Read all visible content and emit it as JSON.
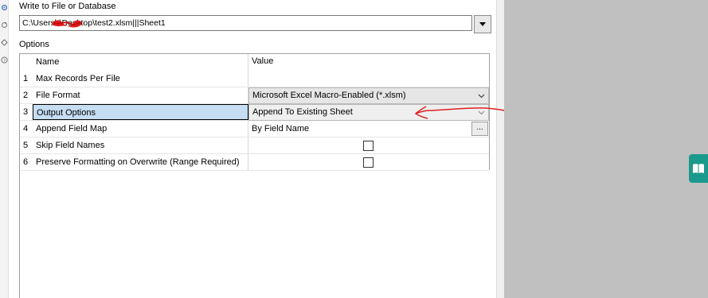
{
  "section": {
    "title": "Write to File or Database",
    "options_label": "Options"
  },
  "path": {
    "value": "C:\\Users\\        \\Desktop\\test2.xlsm|||Sheet1"
  },
  "grid": {
    "headers": {
      "name": "Name",
      "value": "Value"
    },
    "rows": [
      {
        "num": "1",
        "name": "Max Records Per File",
        "value": ""
      },
      {
        "num": "2",
        "name": "File Format",
        "value": "Microsoft Excel Macro-Enabled (*.xlsm)"
      },
      {
        "num": "3",
        "name": "Output Options",
        "value": "Append To Existing Sheet"
      },
      {
        "num": "4",
        "name": "Append Field Map",
        "value": "By Field Name",
        "button": "..."
      },
      {
        "num": "5",
        "name": "Skip Field Names",
        "checked": false
      },
      {
        "num": "6",
        "name": "Preserve Formatting on Overwrite (Range Required)",
        "checked": false
      }
    ]
  },
  "colors": {
    "selected_row": "#c6ddf2",
    "annotation": "#e02020",
    "canvas": "#c0c0c0",
    "tool_icon": "#1a9a8c"
  },
  "icons": {
    "side": [
      "gear-icon",
      "refresh-icon",
      "tag-icon",
      "help-icon"
    ],
    "canvas_tool": "book-icon"
  }
}
